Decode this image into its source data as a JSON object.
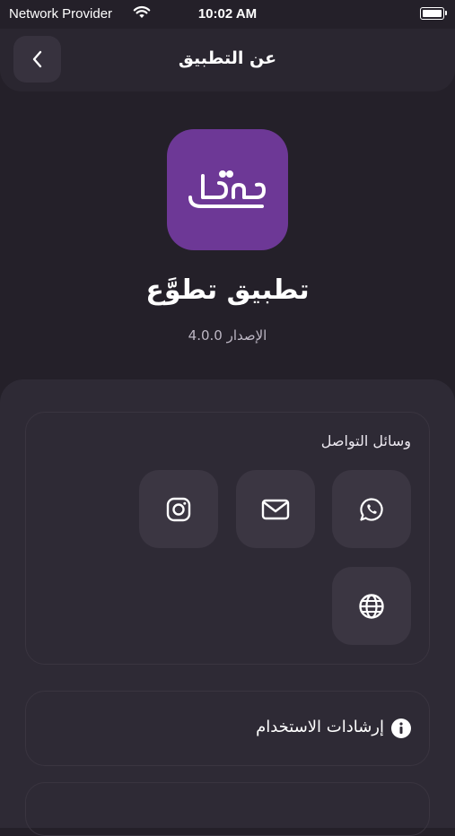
{
  "status_bar": {
    "carrier": "Network Provider",
    "time": "10:02 AM"
  },
  "header": {
    "title": "عن التطبيق",
    "back_icon": "chevron-left-icon"
  },
  "app": {
    "name": "تطبيق تطوَّع",
    "version": "الإصدار 4.0.0",
    "logo_text": "تطوع",
    "logo_color": "#6d3896"
  },
  "contact": {
    "title": "وسائل التواصل",
    "channels": [
      {
        "icon": "whatsapp-icon"
      },
      {
        "icon": "email-icon"
      },
      {
        "icon": "instagram-icon"
      },
      {
        "icon": "website-icon"
      }
    ]
  },
  "menu": {
    "usage_guide_label": "إرشادات الاستخدام",
    "usage_guide_icon": "info-icon"
  }
}
